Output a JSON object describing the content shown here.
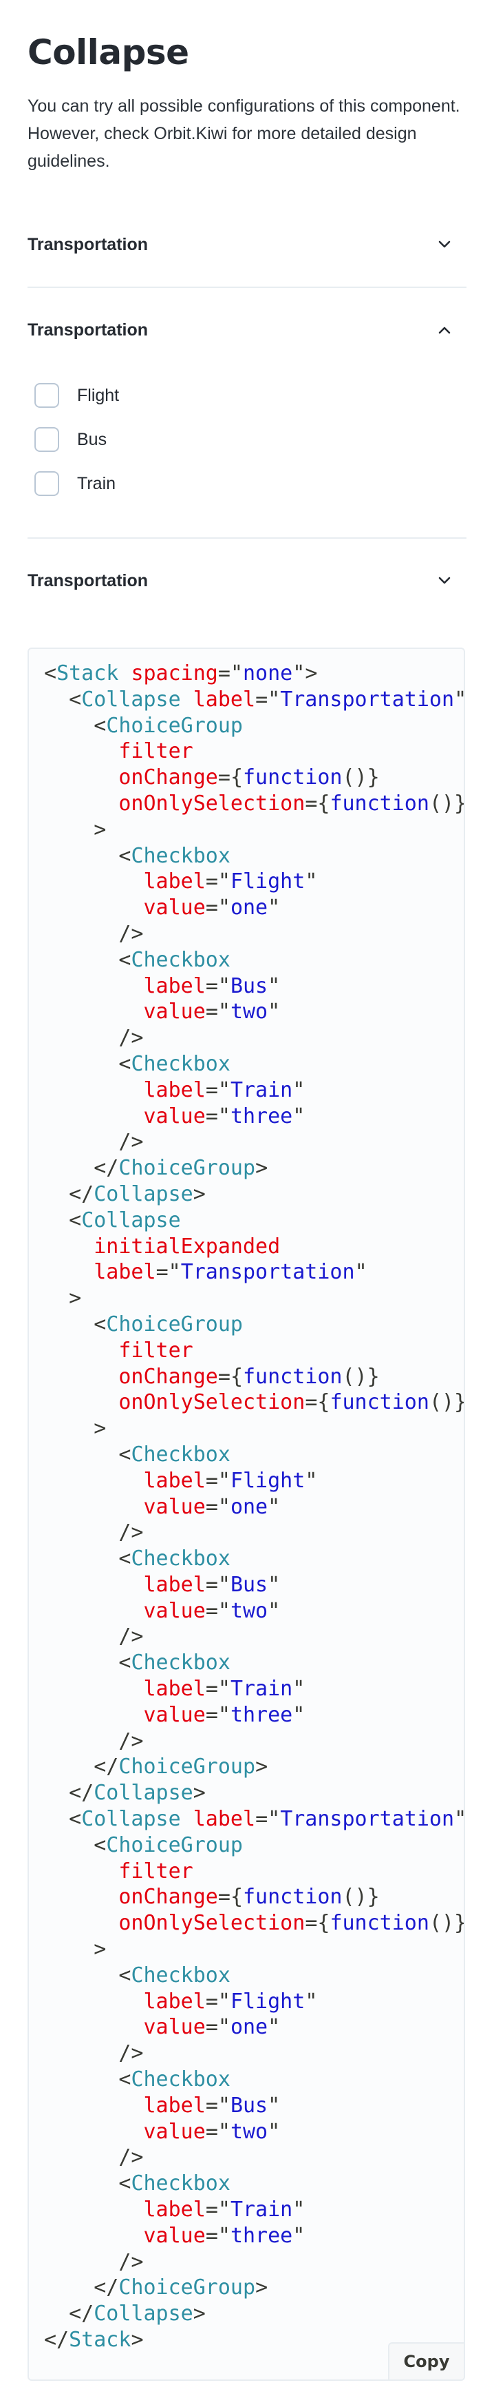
{
  "page": {
    "title": "Collapse",
    "intro": "You can try all possible configurations of this component. However, check Orbit.Kiwi for more detailed design guidelines."
  },
  "collapses": [
    {
      "label": "Transportation",
      "expanded": false,
      "chevron": "chevron-down-icon"
    },
    {
      "label": "Transportation",
      "expanded": true,
      "chevron": "chevron-up-icon",
      "options": [
        {
          "label": "Flight",
          "checked": false
        },
        {
          "label": "Bus",
          "checked": false
        },
        {
          "label": "Train",
          "checked": false
        }
      ]
    },
    {
      "label": "Transportation",
      "expanded": false,
      "chevron": "chevron-down-icon"
    }
  ],
  "code": {
    "copy_label": "Copy",
    "lines": [
      "<Stack spacing=\"none\">",
      "  <Collapse label=\"Transportation\">",
      "    <ChoiceGroup",
      "      filter",
      "      onChange={function()}",
      "      onOnlySelection={function()}",
      "    >",
      "      <Checkbox",
      "        label=\"Flight\"",
      "        value=\"one\"",
      "      />",
      "      <Checkbox",
      "        label=\"Bus\"",
      "        value=\"two\"",
      "      />",
      "      <Checkbox",
      "        label=\"Train\"",
      "        value=\"three\"",
      "      />",
      "    </ChoiceGroup>",
      "  </Collapse>",
      "  <Collapse",
      "    initialExpanded",
      "    label=\"Transportation\"",
      "  >",
      "    <ChoiceGroup",
      "      filter",
      "      onChange={function()}",
      "      onOnlySelection={function()}",
      "    >",
      "      <Checkbox",
      "        label=\"Flight\"",
      "        value=\"one\"",
      "      />",
      "      <Checkbox",
      "        label=\"Bus\"",
      "        value=\"two\"",
      "      />",
      "      <Checkbox",
      "        label=\"Train\"",
      "        value=\"three\"",
      "      />",
      "    </ChoiceGroup>",
      "  </Collapse>",
      "  <Collapse label=\"Transportation\">",
      "    <ChoiceGroup",
      "      filter",
      "      onChange={function()}",
      "      onOnlySelection={function()}",
      "    >",
      "      <Checkbox",
      "        label=\"Flight\"",
      "        value=\"one\"",
      "      />",
      "      <Checkbox",
      "        label=\"Bus\"",
      "        value=\"two\"",
      "      />",
      "      <Checkbox",
      "        label=\"Train\"",
      "        value=\"three\"",
      "      />",
      "    </ChoiceGroup>",
      "  </Collapse>",
      "</Stack>"
    ]
  },
  "colors": {
    "tag": "#2e8fa3",
    "attribute": "#e3000f",
    "string": "#1a1acf",
    "punctuation": "#393a34",
    "divider": "#e8edf1",
    "checkbox_border": "#bac7d5"
  }
}
